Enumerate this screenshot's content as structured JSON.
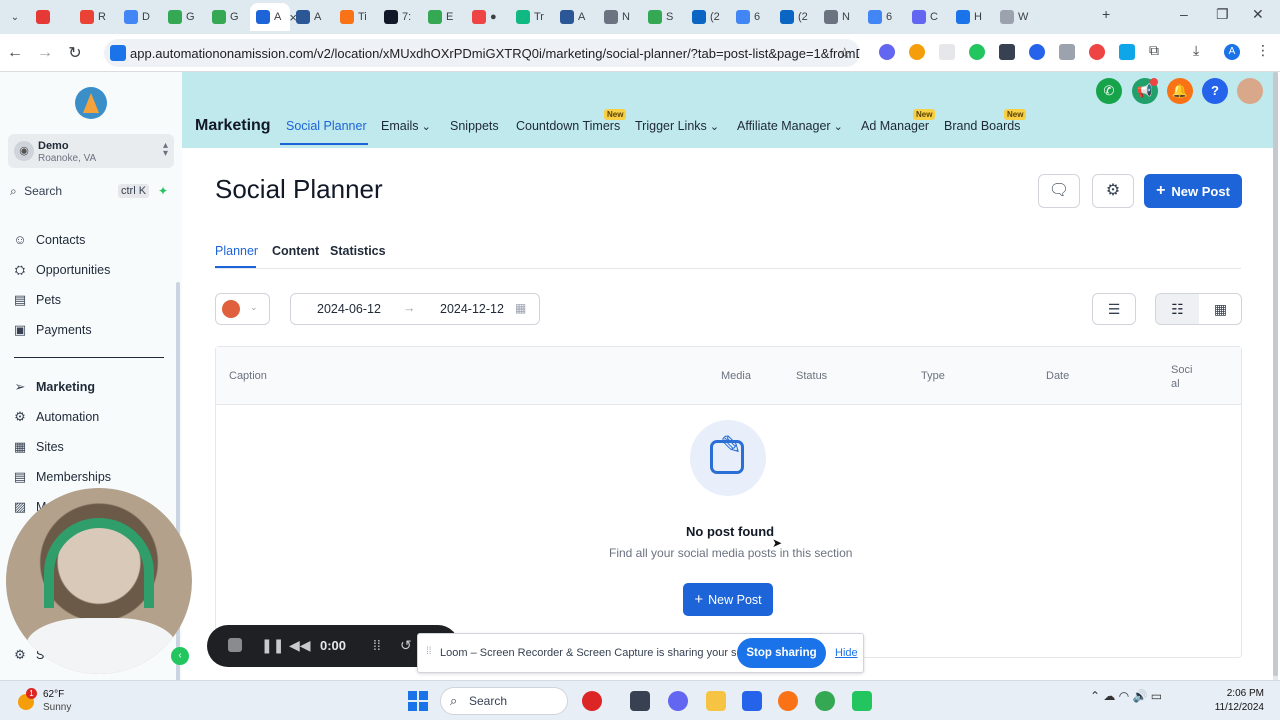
{
  "browser": {
    "tabs": [
      {
        "label": "",
        "color": "#e53935"
      },
      {
        "label": "R",
        "color": "#ea4335"
      },
      {
        "label": "D",
        "color": "#4285f4"
      },
      {
        "label": "G",
        "color": "#34a853"
      },
      {
        "label": "G",
        "color": "#34a853"
      },
      {
        "label": "A",
        "color": "#1d64d8",
        "active": true
      },
      {
        "label": "A",
        "color": "#2b5797"
      },
      {
        "label": "Ti",
        "color": "#f97316"
      },
      {
        "label": "7:",
        "color": "#111827"
      },
      {
        "label": "E",
        "color": "#34a853"
      },
      {
        "label": "●",
        "color": "#ef4444"
      },
      {
        "label": "Tr",
        "color": "#10b981"
      },
      {
        "label": "A",
        "color": "#2b5797"
      },
      {
        "label": "N",
        "color": "#6b7280"
      },
      {
        "label": "S",
        "color": "#34a853"
      },
      {
        "label": "(2",
        "color": "#0a66c2"
      },
      {
        "label": "6",
        "color": "#4285f4"
      },
      {
        "label": "(2",
        "color": "#0a66c2"
      },
      {
        "label": "N",
        "color": "#6b7280"
      },
      {
        "label": "6",
        "color": "#4285f4"
      },
      {
        "label": "C",
        "color": "#6366f1"
      },
      {
        "label": "H",
        "color": "#1a73e8"
      },
      {
        "label": "W",
        "color": "#9ca3af"
      }
    ],
    "url": "app.automationonamission.com/v2/location/xMUxdhOXrPDmiGXTRQ0i/marketing/social-planner/?tab=post-list&page=1&fromDate...",
    "profile_initial": "A"
  },
  "sidebar": {
    "account_name": "Demo",
    "account_location": "Roanoke, VA",
    "search_label": "Search",
    "search_shortcut": "ctrl K",
    "items": [
      {
        "label": "Contacts",
        "icon": "contacts-icon"
      },
      {
        "label": "Opportunities",
        "icon": "opportunities-icon"
      },
      {
        "label": "Pets",
        "icon": "pets-icon"
      },
      {
        "label": "Payments",
        "icon": "payments-icon"
      },
      {
        "label": "Marketing",
        "icon": "send-icon",
        "active": true
      },
      {
        "label": "Automation",
        "icon": "automation-icon"
      },
      {
        "label": "Sites",
        "icon": "sites-icon"
      },
      {
        "label": "Memberships",
        "icon": "memberships-icon"
      },
      {
        "label": "M",
        "icon": "media-icon"
      }
    ],
    "settings_label": "S"
  },
  "header": {
    "section_title": "Marketing",
    "tabs": [
      {
        "label": "Social Planner",
        "active": true
      },
      {
        "label": "Emails",
        "dropdown": true
      },
      {
        "label": "Snippets"
      },
      {
        "label": "Countdown Timers",
        "badge": "New"
      },
      {
        "label": "Trigger Links",
        "dropdown": true
      },
      {
        "label": "Affiliate Manager",
        "dropdown": true
      },
      {
        "label": "Ad Manager",
        "badge": "New"
      },
      {
        "label": "Brand Boards",
        "badge": "New"
      }
    ],
    "icon_colors": {
      "phone": "#16a34a",
      "megaphone": "#22a06b",
      "bell": "#f97316",
      "help": "#2563eb"
    }
  },
  "page": {
    "title": "Social Planner",
    "new_post_label": "New Post",
    "subtabs": [
      {
        "label": "Planner",
        "active": true
      },
      {
        "label": "Content"
      },
      {
        "label": "Statistics"
      }
    ],
    "date_from": "2024-06-12",
    "date_to": "2024-12-12",
    "table_headers": [
      "Caption",
      "Media",
      "Status",
      "Type",
      "Date",
      "Soci al"
    ],
    "empty_title": "No post found",
    "empty_subtitle": "Find all your social media posts in this section",
    "empty_button_label": "New Post",
    "accent_color": "#1d64d8"
  },
  "loom": {
    "timer": "0:00",
    "share_message": "Loom – Screen Recorder & Screen Capture is sharing your screen.",
    "stop_label": "Stop sharing",
    "hide_label": "Hide"
  },
  "taskbar": {
    "weather_temp": "62°F",
    "weather_cond": "Sunny",
    "weather_badge": "1",
    "search_label": "Search",
    "time": "2:06 PM",
    "date": "11/12/2024"
  }
}
